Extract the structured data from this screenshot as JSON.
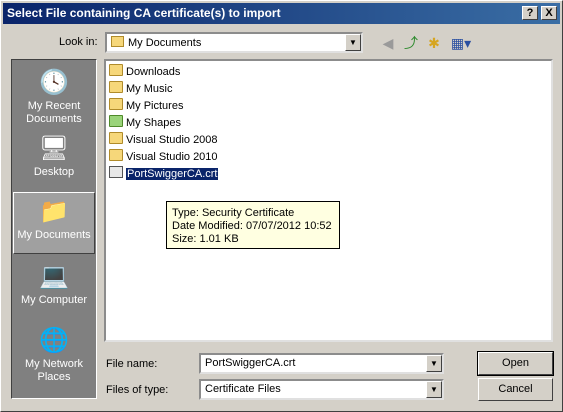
{
  "window": {
    "title": "Select File containing CA certificate(s) to import",
    "help_label": "?",
    "close_label": "X"
  },
  "toolbar": {
    "look_in_label": "Look in:",
    "look_in_value": "My Documents",
    "icons": [
      "back-icon",
      "up-folder-icon",
      "new-folder-icon",
      "views-menu-icon"
    ]
  },
  "places": [
    {
      "id": "recent",
      "label": "My Recent Documents",
      "icon": "recent-documents-icon"
    },
    {
      "id": "desktop",
      "label": "Desktop",
      "icon": "desktop-icon"
    },
    {
      "id": "documents",
      "label": "My Documents",
      "icon": "my-documents-icon",
      "selected": true
    },
    {
      "id": "computer",
      "label": "My Computer",
      "icon": "my-computer-icon"
    },
    {
      "id": "network",
      "label": "My Network Places",
      "icon": "network-places-icon"
    }
  ],
  "files": [
    {
      "name": "Downloads",
      "type": "folder"
    },
    {
      "name": "My Music",
      "type": "folder"
    },
    {
      "name": "My Pictures",
      "type": "folder"
    },
    {
      "name": "My Shapes",
      "type": "folder"
    },
    {
      "name": "Visual Studio 2008",
      "type": "folder"
    },
    {
      "name": "Visual Studio 2010",
      "type": "folder"
    },
    {
      "name": "PortSwiggerCA.crt",
      "type": "certificate",
      "selected": true
    }
  ],
  "tooltip": {
    "type": "Type: Security Certificate",
    "modified": "Date Modified: 07/07/2012 10:52",
    "size": "Size: 1.01 KB"
  },
  "footer": {
    "file_name_label": "File name:",
    "file_name_value": "PortSwiggerCA.crt",
    "file_type_label": "Files of type:",
    "file_type_value": "Certificate Files",
    "open_label": "Open",
    "cancel_label": "Cancel"
  }
}
